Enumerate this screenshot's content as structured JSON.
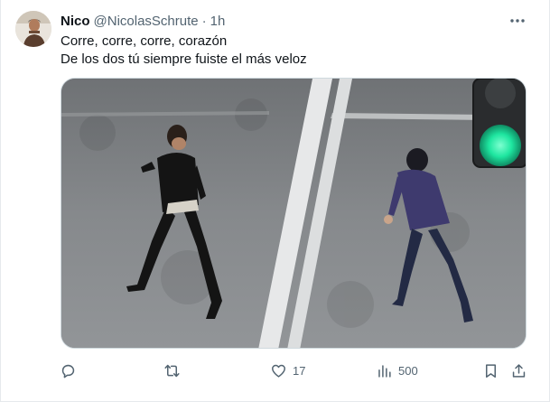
{
  "tweet": {
    "display_name": "Nico",
    "handle": "@NicolasSchrute",
    "separator": "·",
    "time": "1h",
    "lines": [
      "Corre, corre, corre, corazón",
      "De los dos tú siempre fuiste el más veloz"
    ]
  },
  "media": {
    "description_icon": "video-still",
    "traffic_light_color": "#1ee6a0"
  },
  "actions": {
    "reply_count": "",
    "retweet_count": "",
    "like_count": "17",
    "views_count": "500"
  },
  "icons": {
    "more": "more-dots-icon",
    "reply": "reply-icon",
    "retweet": "retweet-icon",
    "like": "heart-icon",
    "views": "views-icon",
    "bookmark": "bookmark-icon",
    "share": "share-icon"
  },
  "colors": {
    "text": "#0f1419",
    "secondary": "#536471",
    "border": "#cfd9de"
  }
}
